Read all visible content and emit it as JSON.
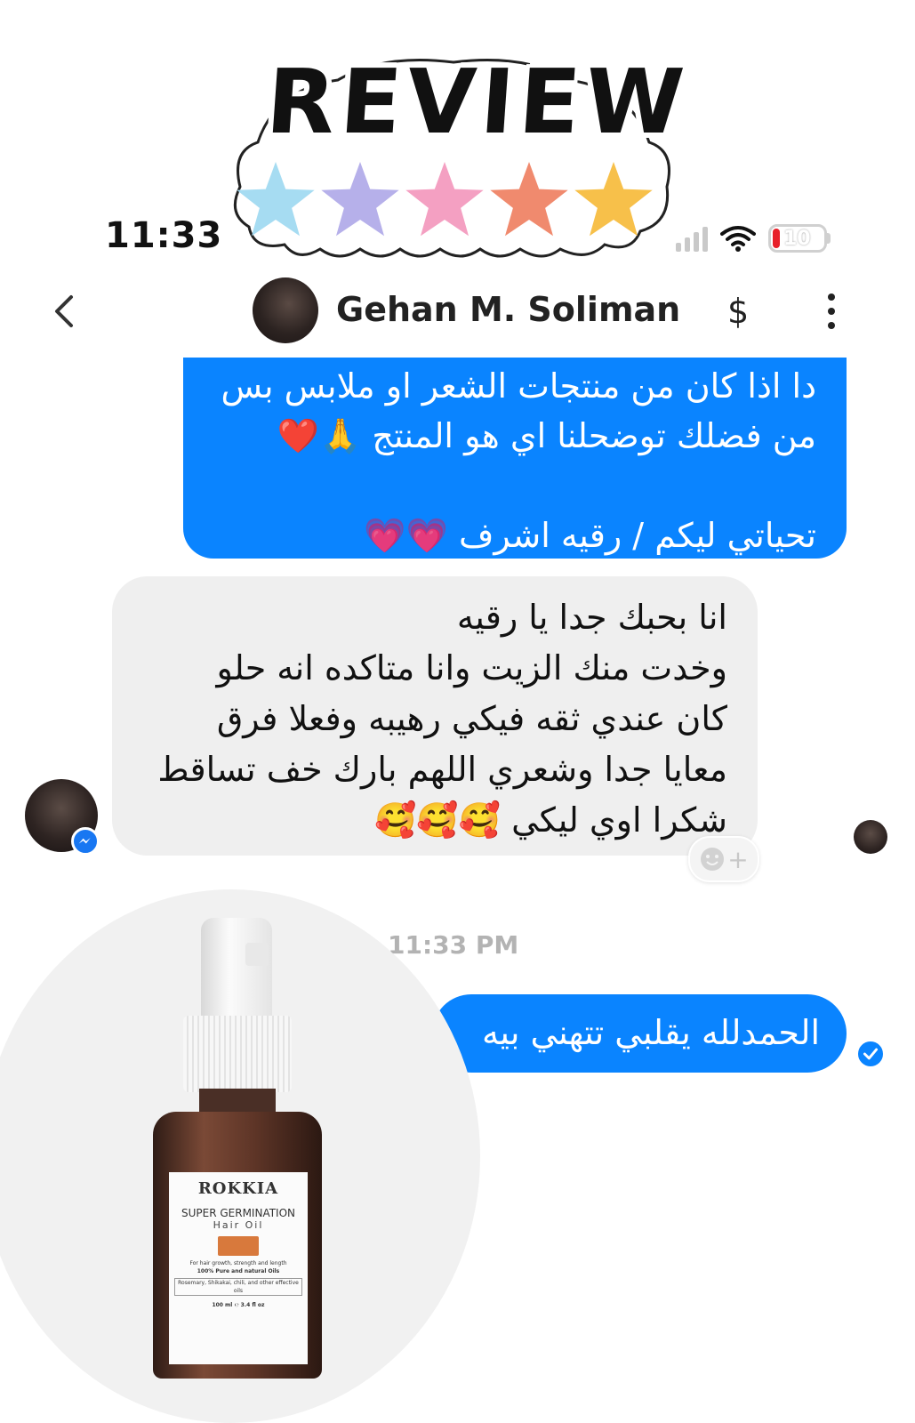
{
  "sticker": {
    "title": "REVIEW",
    "rating": 5,
    "star_colors": [
      "#a6dcf2",
      "#b6b0ea",
      "#f4a0c2",
      "#f08a6e",
      "#f7c04a"
    ]
  },
  "status_bar": {
    "time": "11:33",
    "battery": "10"
  },
  "header": {
    "contact_name": "Gehan M. Soliman",
    "dollar_label": "$"
  },
  "messages": {
    "outgoing_1_lines": [
      "دا اذا كان من منتجات الشعر او ملابس بس",
      "من فضلك توضحلنا اي هو المنتج 🙏❤️",
      "",
      "تحياتي ليكم / رقيه اشرف 💗💗"
    ],
    "incoming_lines": [
      "انا بحبك جدا يا رقيه",
      "وخدت منك الزيت وانا متاكده انه حلو",
      "كان عندي ثقه فيكي رهيبه وفعلا فرق",
      "معايا جدا وشعري اللهم بارك خف تساقط",
      "شكرا اوي ليكي 🥰🥰🥰"
    ],
    "reaction_plus": "+",
    "timestamp": "11:33 PM",
    "outgoing_2": "الحمدلله يقلبي تتهني بيه"
  },
  "product": {
    "brand": "ROKKIA",
    "name": "SUPER GERMINATION",
    "type": "Hair Oil",
    "line1": "For hair growth, strength and length",
    "line2": "100% Pure and natural Oils",
    "line3": "Rosemary, Shikakai, chili, and other effective oils",
    "volume": "100 ml ℮ 3.4 fl oz"
  },
  "colors": {
    "outgoing_bubble": "#0a84ff",
    "incoming_bubble": "#efefef"
  }
}
